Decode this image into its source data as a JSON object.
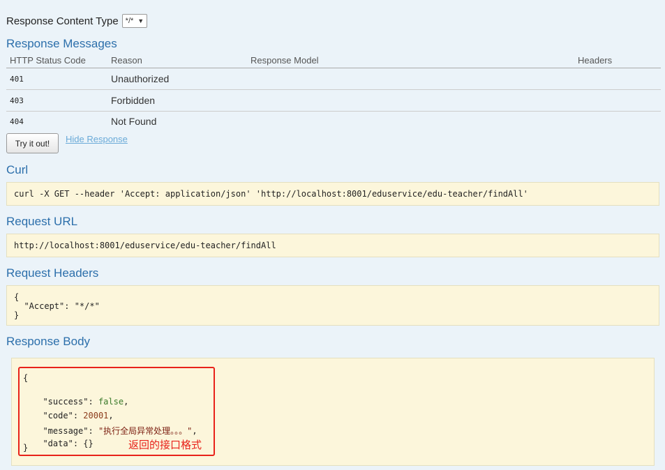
{
  "content_type": {
    "label": "Response Content Type",
    "selected": "*/*"
  },
  "messages": {
    "title": "Response Messages",
    "columns": [
      "HTTP Status Code",
      "Reason",
      "Response Model",
      "Headers"
    ],
    "rows": [
      {
        "code": "401",
        "reason": "Unauthorized"
      },
      {
        "code": "403",
        "reason": "Forbidden"
      },
      {
        "code": "404",
        "reason": "Not Found"
      }
    ]
  },
  "actions": {
    "try_label": "Try it out!",
    "hide_label": "Hide Response"
  },
  "curl": {
    "title": "Curl",
    "command": "curl -X GET --header 'Accept: application/json' 'http://localhost:8001/eduservice/edu-teacher/findAll'"
  },
  "request_url": {
    "title": "Request URL",
    "value": "http://localhost:8001/eduservice/edu-teacher/findAll"
  },
  "request_headers": {
    "title": "Request Headers",
    "lines": [
      "{",
      "  \"Accept\": \"*/*\"",
      "}"
    ]
  },
  "response_body": {
    "title": "Response Body",
    "open": "{",
    "close": "}",
    "fields": [
      {
        "key": "\"success\"",
        "value": "false",
        "suffix": ","
      },
      {
        "key": "\"code\"",
        "value": "20001",
        "suffix": ","
      },
      {
        "key": "\"message\"",
        "value": "\"执行全局异常处理。。。\"",
        "suffix": ","
      },
      {
        "key": "\"data\"",
        "value": "{}",
        "suffix": ""
      }
    ],
    "annotation": "返回的接口格式"
  },
  "colors": {
    "heading": "#2c6fab",
    "code_bg": "#fcf6db",
    "highlight": "#e8221a",
    "link": "#6aaad8"
  }
}
